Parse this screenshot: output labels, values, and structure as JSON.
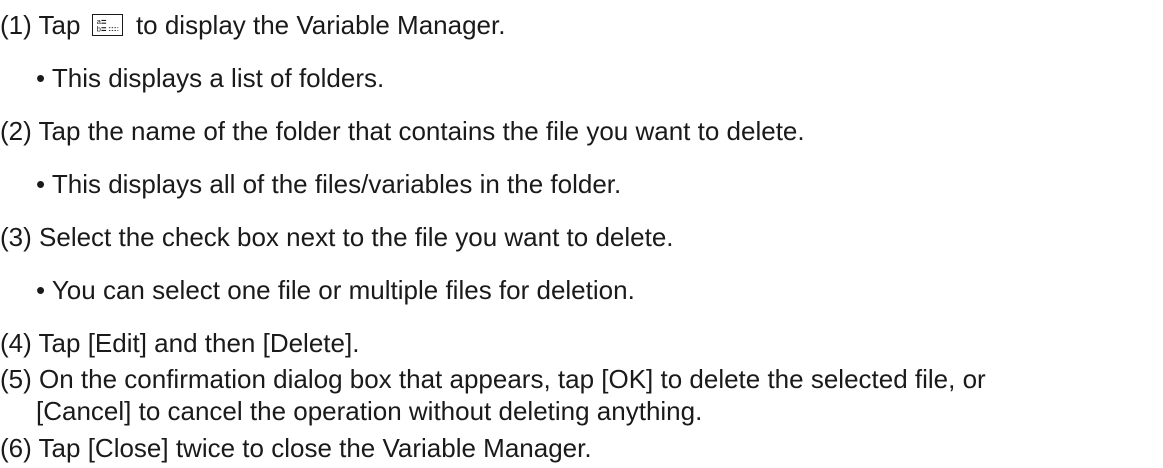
{
  "steps": [
    {
      "num": "(1)",
      "before_icon": "Tap",
      "icon": "variable-manager-icon",
      "after_icon": "to display the Variable Manager.",
      "note": "• This displays a list of folders."
    },
    {
      "num": "(2)",
      "text": "Tap the name of the folder that contains the file you want to delete.",
      "note": "• This displays all of the files/variables in the folder."
    },
    {
      "num": "(3)",
      "text": "Select the check box next to the file you want to delete.",
      "note": "• You can select one file or multiple files for deletion."
    },
    {
      "num": "(4)",
      "text": "Tap [Edit] and then [Delete]."
    },
    {
      "num": "(5)",
      "text": "On the confirmation dialog box that appears, tap [OK] to delete the selected file, or",
      "text_cont": "[Cancel] to cancel the operation without deleting anything."
    },
    {
      "num": "(6)",
      "text": "Tap [Close] twice to close the Variable Manager."
    }
  ]
}
